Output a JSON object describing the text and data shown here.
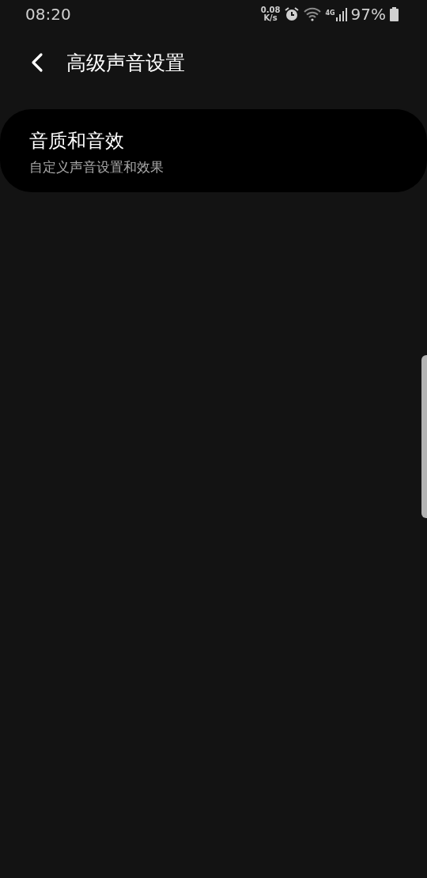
{
  "status_bar": {
    "time": "08:20",
    "net_speed": "0.08",
    "net_unit": "K/s",
    "network": "4G",
    "battery": "97%"
  },
  "header": {
    "title": "高级声音设置"
  },
  "items": [
    {
      "title": "音质和音效",
      "subtitle": "自定义声音设置和效果"
    }
  ]
}
